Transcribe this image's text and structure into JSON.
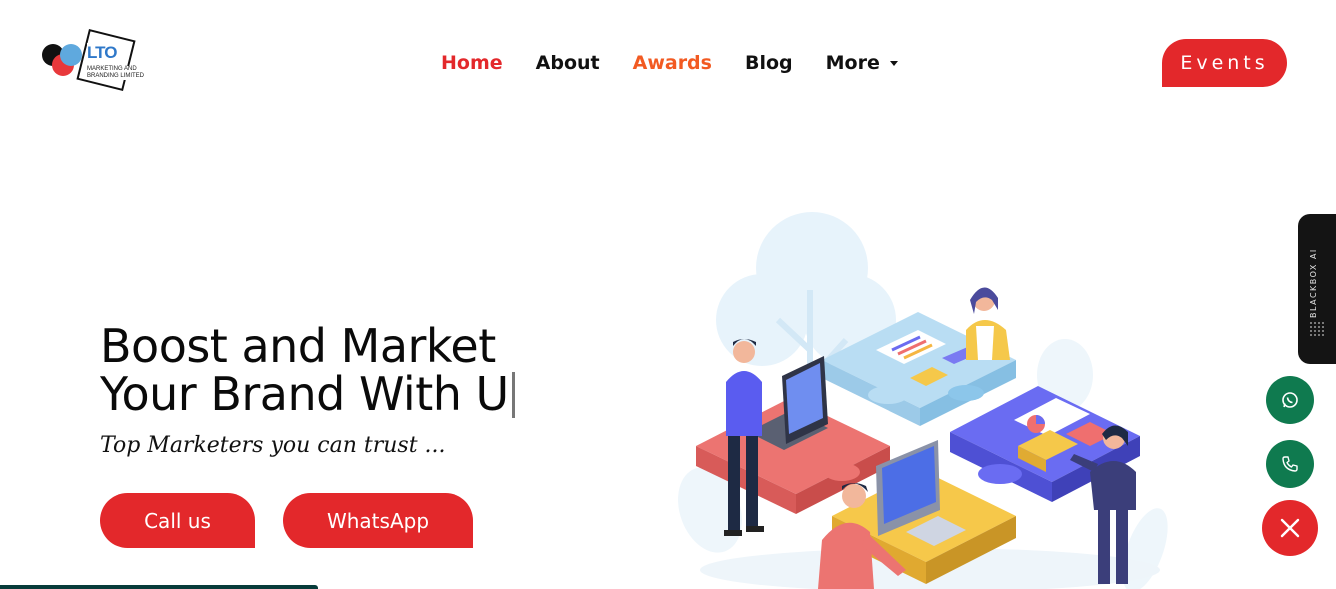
{
  "header": {
    "logo": {
      "brand": "LTO",
      "subtitle_line1": "MARKETING AND",
      "subtitle_line2": "BRANDING LIMITED",
      "icon": "lto-logo-icon"
    },
    "nav": [
      {
        "label": "Home"
      },
      {
        "label": "About"
      },
      {
        "label": "Awards"
      },
      {
        "label": "Blog"
      },
      {
        "label": "More"
      }
    ],
    "events_label": "Events"
  },
  "colors": {
    "accent": "#e3282b",
    "awards": "#f25a22",
    "whatsapp": "#0f7a4f",
    "dark_panel": "#141414"
  },
  "hero": {
    "title_line1": "Boost and Market",
    "title_line2": "Your Brand With U",
    "subtitle": "Top Marketers you can trust ...",
    "call_label": "Call us",
    "whatsapp_label": "WhatsApp"
  },
  "illustration": {
    "icon": "teamwork-puzzle-illustration"
  },
  "side": {
    "blackbox_label": "BLACKBOX AI",
    "icons": [
      "whatsapp-icon",
      "phone-icon",
      "close-icon"
    ]
  }
}
